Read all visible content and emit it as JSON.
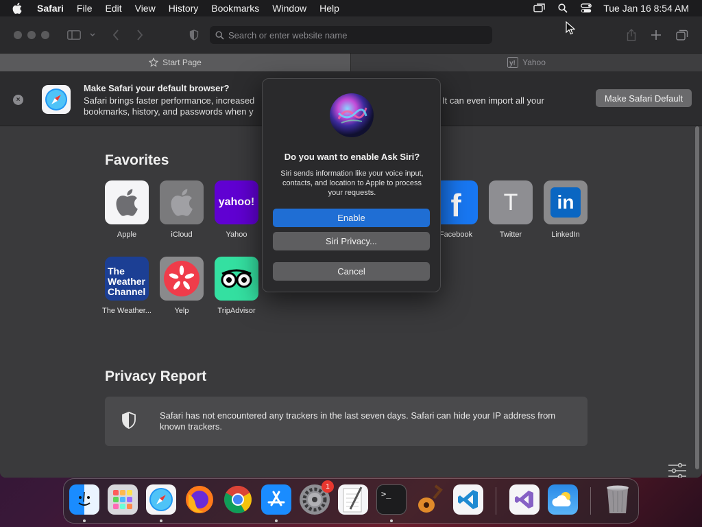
{
  "menubar": {
    "app": "Safari",
    "items": [
      "File",
      "Edit",
      "View",
      "History",
      "Bookmarks",
      "Window",
      "Help"
    ],
    "clock": "Tue Jan 16  8:54 AM"
  },
  "toolbar": {
    "search_placeholder": "Search or enter website name"
  },
  "tabs": [
    {
      "label": "Start Page",
      "active": true
    },
    {
      "label": "Yahoo",
      "active": false
    }
  ],
  "banner": {
    "title": "Make Safari your default browser?",
    "text_line1": "Safari brings faster performance, increased",
    "text_line2": "bookmarks, history, and passwords when y",
    "text_right": "It can even import all your",
    "button": "Make Safari Default"
  },
  "favorites": {
    "title": "Favorites",
    "items": [
      {
        "label": "Apple"
      },
      {
        "label": "iCloud"
      },
      {
        "label": "Yahoo"
      },
      {
        "label": "Facebook"
      },
      {
        "label": "Twitter"
      },
      {
        "label": "LinkedIn"
      },
      {
        "label": "The Weather..."
      },
      {
        "label": "Yelp"
      },
      {
        "label": "TripAdvisor"
      }
    ],
    "tile_text": {
      "yahoo": "yahoo!",
      "facebook": "f",
      "twitter": "T",
      "linkedin": "in",
      "weather": "The Weather Channel"
    }
  },
  "privacy": {
    "title": "Privacy Report",
    "text": "Safari has not encountered any trackers in the last seven days. Safari can hide your IP address from known trackers."
  },
  "dialog": {
    "title": "Do you want to enable Ask Siri?",
    "text": "Siri sends information like your voice input, contacts, and location to Apple to process your requests.",
    "enable": "Enable",
    "privacy": "Siri Privacy...",
    "cancel": "Cancel"
  },
  "dock": {
    "settings_badge": "1",
    "terminal_prompt": ">_",
    "items": [
      "finder",
      "launchpad",
      "safari",
      "firefox",
      "chrome",
      "app-store",
      "system-settings",
      "textedit",
      "terminal",
      "garageband",
      "vscode",
      "visual-studio",
      "weather",
      "trash"
    ]
  },
  "colors": {
    "accent": "#1f6ed4",
    "yahoo": "#6001d2",
    "facebook": "#1877f2",
    "linkedin": "#0a66c2",
    "yelp": "#d32323",
    "tripadvisor": "#34e0a1",
    "weather": "#1c3f94"
  }
}
